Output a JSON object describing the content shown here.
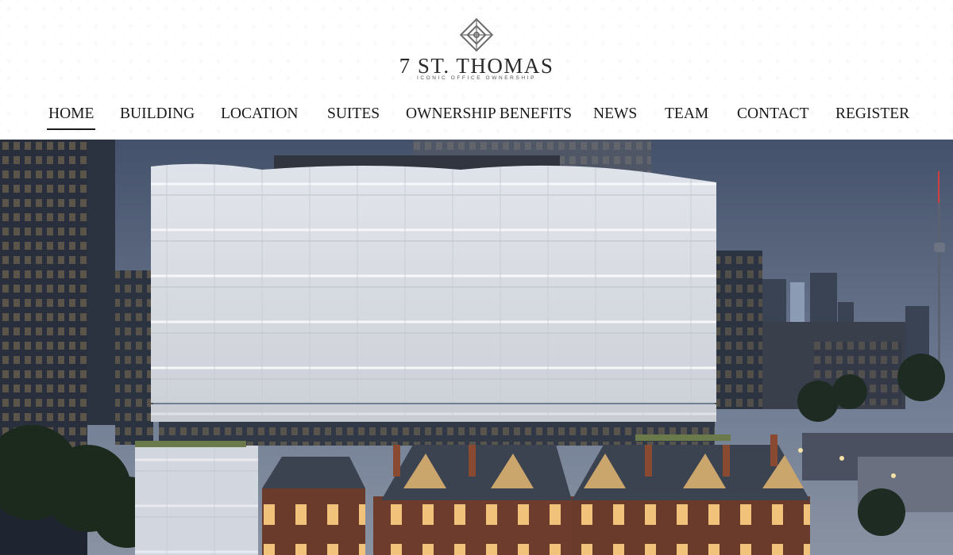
{
  "brand": {
    "name": "7 ST. THOMAS",
    "tagline": "ICONIC OFFICE OWNERSHIP",
    "logo_icon": "knot-emblem-icon"
  },
  "nav": {
    "active": "home",
    "items": [
      {
        "id": "home",
        "label": "HOME"
      },
      {
        "id": "building",
        "label": "BUILDING"
      },
      {
        "id": "location",
        "label": "LOCATION"
      },
      {
        "id": "suites",
        "label": "SUITES"
      },
      {
        "id": "ownership-benefits",
        "label": "OWNERSHIP BENEFITS"
      },
      {
        "id": "news",
        "label": "NEWS"
      },
      {
        "id": "team",
        "label": "TEAM"
      },
      {
        "id": "contact",
        "label": "CONTACT"
      },
      {
        "id": "register",
        "label": "REGISTER"
      }
    ]
  },
  "hero": {
    "image_subject": "Rendering of a glass office tower above heritage brick Victorian houses at dusk, with the city skyline and CN Tower in the background"
  },
  "colors": {
    "text": "#1a1a1a",
    "sky_top": "#44516a",
    "sky_bottom": "#7d8aa0",
    "glass": "#e9ecf1",
    "brick": "#6a3a2a",
    "roof": "#3b4250"
  }
}
